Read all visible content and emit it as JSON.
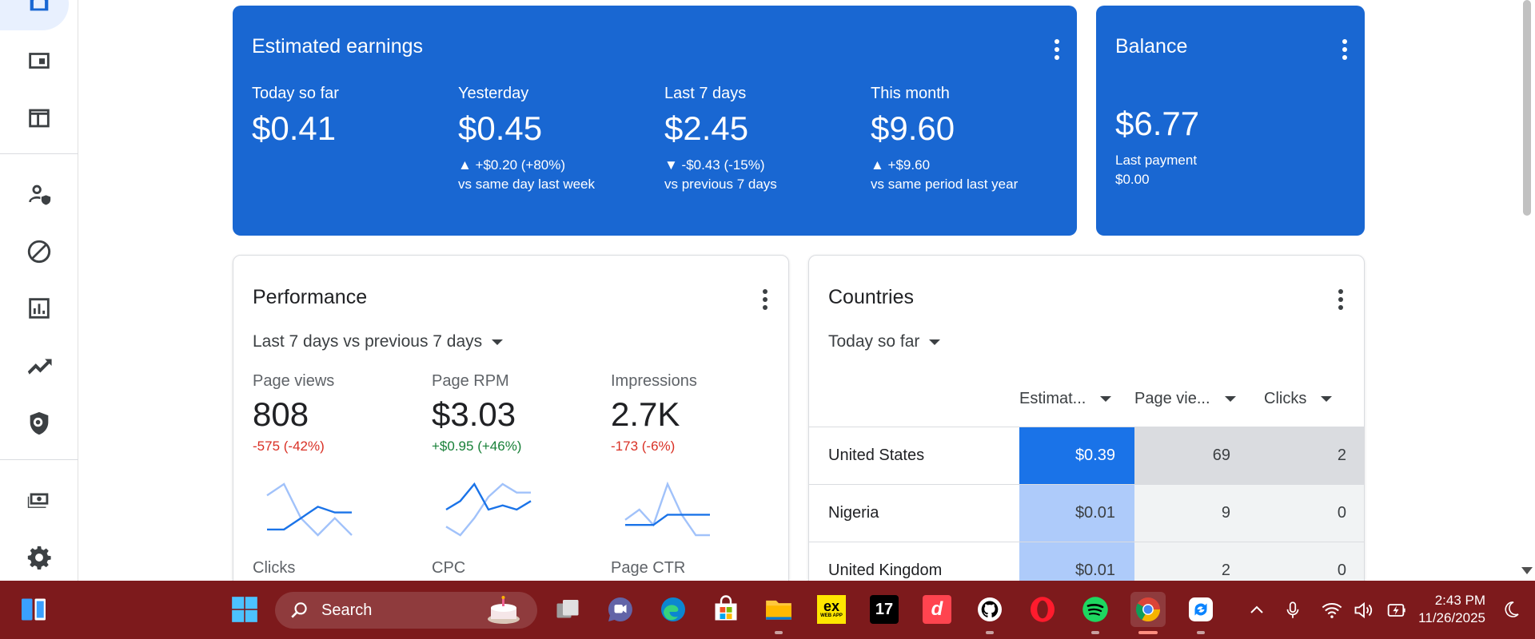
{
  "earnings": {
    "title": "Estimated earnings",
    "metrics": [
      {
        "label": "Today so far",
        "value": "$0.41",
        "change": "",
        "compare": ""
      },
      {
        "label": "Yesterday",
        "value": "$0.45",
        "change": "▲ +$0.20 (+80%)",
        "compare": "vs same day last week"
      },
      {
        "label": "Last 7 days",
        "value": "$2.45",
        "change": "▼ -$0.43 (-15%)",
        "compare": "vs previous 7 days"
      },
      {
        "label": "This month",
        "value": "$9.60",
        "change": "▲ +$9.60",
        "compare": "vs same period last year"
      }
    ]
  },
  "balance": {
    "title": "Balance",
    "value": "$6.77",
    "last_payment_label": "Last payment",
    "last_payment_value": "$0.00"
  },
  "performance": {
    "title": "Performance",
    "range": "Last 7 days vs previous 7 days",
    "metrics": [
      {
        "label": "Page views",
        "value": "808",
        "change": "-575 (-42%)",
        "trend": "negative",
        "current": [
          4,
          4,
          6,
          8,
          7,
          7
        ],
        "previous": [
          10,
          12,
          6,
          3,
          6,
          3
        ]
      },
      {
        "label": "Page RPM",
        "value": "$3.03",
        "change": "+$0.95 (+46%)",
        "trend": "positive",
        "current": [
          6,
          8,
          12,
          6,
          7,
          6,
          8
        ],
        "previous": [
          2,
          0,
          4,
          9,
          12,
          10,
          10
        ]
      },
      {
        "label": "Impressions",
        "value": "2.7K",
        "change": "-173 (-6%)",
        "trend": "negative",
        "current": [
          4,
          4,
          4,
          6,
          6,
          6,
          6
        ],
        "previous": [
          5,
          7,
          4,
          12,
          6,
          2,
          2
        ]
      }
    ],
    "next_labels": [
      "Clicks",
      "CPC",
      "Page CTR"
    ]
  },
  "countries": {
    "title": "Countries",
    "range": "Today so far",
    "columns": [
      "Estimat...",
      "Page vie...",
      "Clicks"
    ],
    "rows": [
      {
        "country": "United States",
        "earnings": "$0.39",
        "pageviews": "69",
        "clicks": "2"
      },
      {
        "country": "Nigeria",
        "earnings": "$0.01",
        "pageviews": "9",
        "clicks": "0"
      },
      {
        "country": "United Kingdom",
        "earnings": "$0.01",
        "pageviews": "2",
        "clicks": "0"
      }
    ]
  },
  "taskbar": {
    "search_placeholder": "Search",
    "time": "2:43 PM",
    "date": "11/26/2025",
    "apps": [
      "start-menu",
      "search",
      "task-view",
      "teams-chat",
      "edge",
      "microsoft-store",
      "file-explorer",
      "exness",
      "tradingview",
      "deriv",
      "github-desktop",
      "opera",
      "spotify",
      "chrome",
      "remote-app"
    ],
    "ex_label": "ex",
    "ex_sub": "WEB APP",
    "tv_label": "17",
    "deriv_label": "d"
  },
  "colors": {
    "accent_blue": "#1967d2",
    "taskbar": "#7d1a1c",
    "negative": "#d93025",
    "positive": "#188038"
  }
}
